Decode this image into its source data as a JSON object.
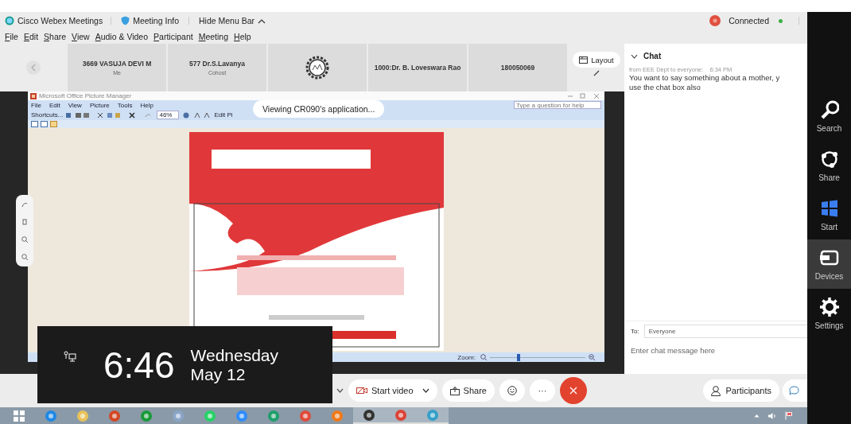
{
  "title_bar": {
    "app": "Cisco Webex Meetings",
    "meeting_info": "Meeting Info",
    "hide_menu": "Hide Menu Bar",
    "status": "Connected"
  },
  "menu": [
    "File",
    "Edit",
    "Share",
    "View",
    "Audio & Video",
    "Participant",
    "Meeting",
    "Help"
  ],
  "participants": [
    {
      "kind": "person",
      "name": "3669 VASUJA DEVI M",
      "role": "Me"
    },
    {
      "kind": "person",
      "name": "577 Dr.S.Lavanya",
      "role": "Cohost"
    },
    {
      "kind": "logo"
    },
    {
      "kind": "person",
      "name": "1000:Dr. B. Loveswara Rao"
    },
    {
      "kind": "person",
      "name": "180050069"
    }
  ],
  "layout_button": "Layout",
  "shared": {
    "banner": "Viewing CR090's application...",
    "app_title": "Microsoft Office Picture Manager",
    "menu": [
      "File",
      "Edit",
      "View",
      "Picture",
      "Tools",
      "Help"
    ],
    "help_placeholder": "Type a question for help",
    "shortcuts": "Shortcuts...",
    "zoom_value": "46%",
    "edit": "Edit Pi",
    "zoom_label": "Zoom:",
    "zoom_slider": {
      "level": 0.3
    }
  },
  "chat": {
    "title": "Chat",
    "messages": [
      {
        "from": "from EEE Dept to everyone:",
        "time": "6:34 PM",
        "lines": [
          "You want to say something about a mother, y",
          "use the chat box also"
        ]
      }
    ],
    "to_label": "To:",
    "to_value": "Everyone",
    "placeholder": "Enter chat message here"
  },
  "controls": {
    "start_video": "Start video",
    "share": "Share",
    "more": "···",
    "participants": "Participants"
  },
  "clock": {
    "time": "6:46",
    "day": "Wednesday",
    "date": "May 12"
  },
  "charms": [
    {
      "kind": "search",
      "label": "Search",
      "selected": false
    },
    {
      "kind": "share",
      "label": "Share",
      "selected": false
    },
    {
      "kind": "start",
      "label": "Start",
      "selected": false
    },
    {
      "kind": "devices",
      "label": "Devices",
      "selected": true
    },
    {
      "kind": "settings",
      "label": "Settings",
      "selected": false
    }
  ]
}
